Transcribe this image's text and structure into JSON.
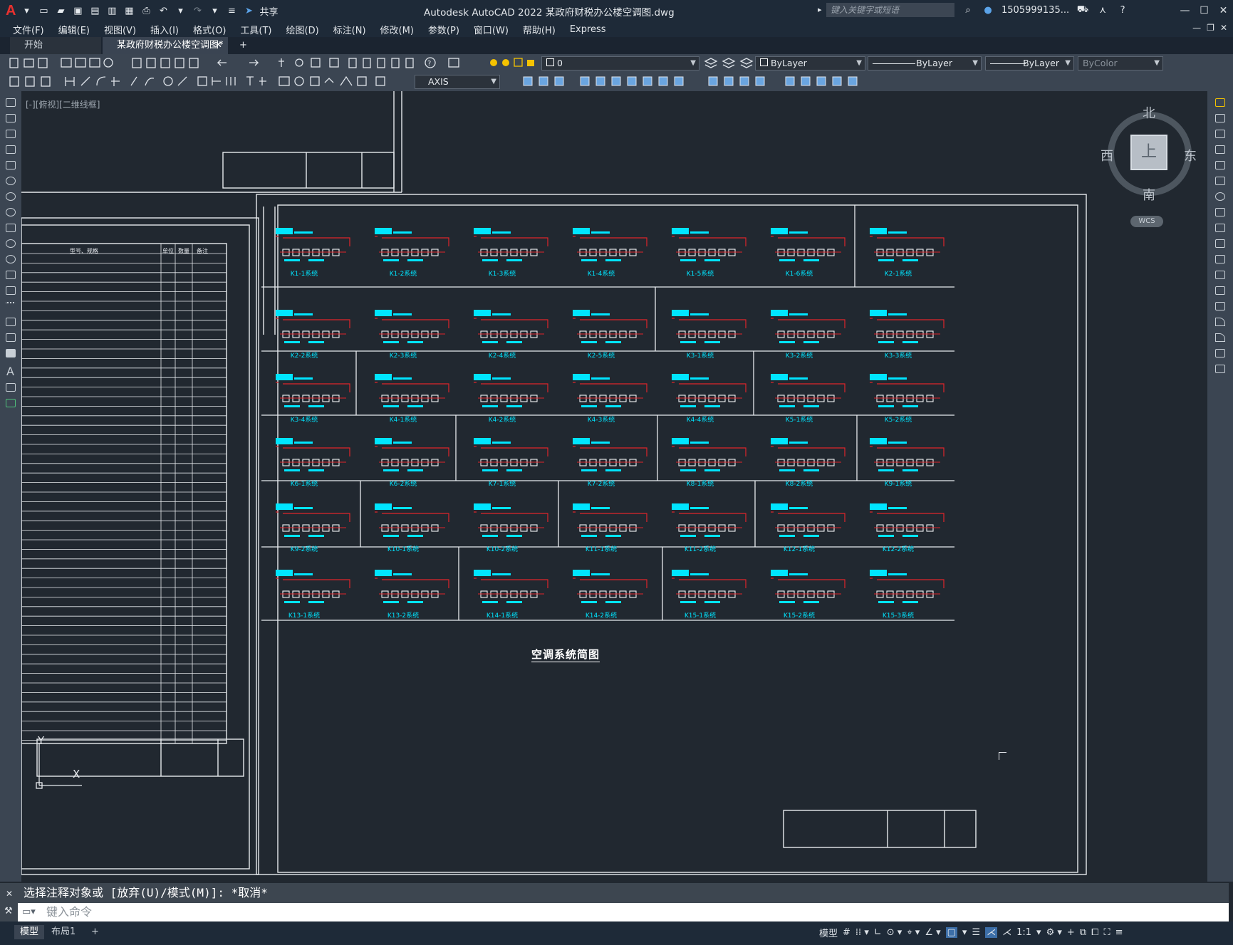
{
  "app": {
    "title": "Autodesk AutoCAD 2022    某政府财税办公楼空调图.dwg",
    "share_label": "共享",
    "search_placeholder": "键入关键字或短语",
    "user": "1505999135...",
    "logo": "A"
  },
  "menu": [
    "文件(F)",
    "编辑(E)",
    "视图(V)",
    "插入(I)",
    "格式(O)",
    "工具(T)",
    "绘图(D)",
    "标注(N)",
    "修改(M)",
    "参数(P)",
    "窗口(W)",
    "帮助(H)",
    "Express"
  ],
  "tabs": {
    "start": "开始",
    "drawing": "某政府财税办公楼空调图*",
    "close": "✕",
    "add": "+"
  },
  "toolbar": {
    "layer_value": "0",
    "color_value": "ByLayer",
    "linetype_value": "ByLayer",
    "lineweight_value": "ByLayer",
    "plotstyle_value": "ByColor",
    "dimstyle_value": "AXIS"
  },
  "viewport": {
    "label": "[-][俯视][二维线框]"
  },
  "viewcube": {
    "north": "北",
    "south": "南",
    "east": "东",
    "west": "西",
    "face": "上",
    "wcs": "WCS"
  },
  "ucs": {
    "x": "X",
    "y": "Y"
  },
  "drawing": {
    "main_title": "空调系统简图",
    "systems": [
      [
        "K1-1系统",
        "K1-2系统",
        "K1-3系统",
        "K1-4系统",
        "K1-5系统",
        "K1-6系统",
        "K2-1系统"
      ],
      [
        "K2-2系统",
        "K2-3系统",
        "K2-4系统",
        "K2-5系统",
        "K3-1系统",
        "K3-2系统",
        "K3-3系统"
      ],
      [
        "K3-4系统",
        "K4-1系统",
        "K4-2系统",
        "K4-3系统",
        "K4-4系统",
        "K5-1系统",
        "K5-2系统"
      ],
      [
        "K6-1系统",
        "K6-2系统",
        "K7-1系统",
        "K7-2系统",
        "K8-1系统",
        "K8-2系统",
        "K9-1系统"
      ],
      [
        "K9-2系统",
        "K10-1系统",
        "K10-2系统",
        "K11-1系统",
        "K11-2系统",
        "K12-1系统",
        "K12-2系统"
      ],
      [
        "K13-1系统",
        "K13-2系统",
        "K14-1系统",
        "K14-2系统",
        "K15-1系统",
        "K15-2系统",
        "K15-3系统"
      ]
    ],
    "table_header": [
      "型号、规格",
      "单位",
      "数量",
      "备注"
    ]
  },
  "command": {
    "history": "选择注释对象或 [放弃(U)/模式(M)]: *取消*",
    "placeholder": "键入命令"
  },
  "status": {
    "model_tab": "模型",
    "layout_tab": "布局1",
    "add": "+",
    "model_space": "模型",
    "scale": "1:1"
  }
}
